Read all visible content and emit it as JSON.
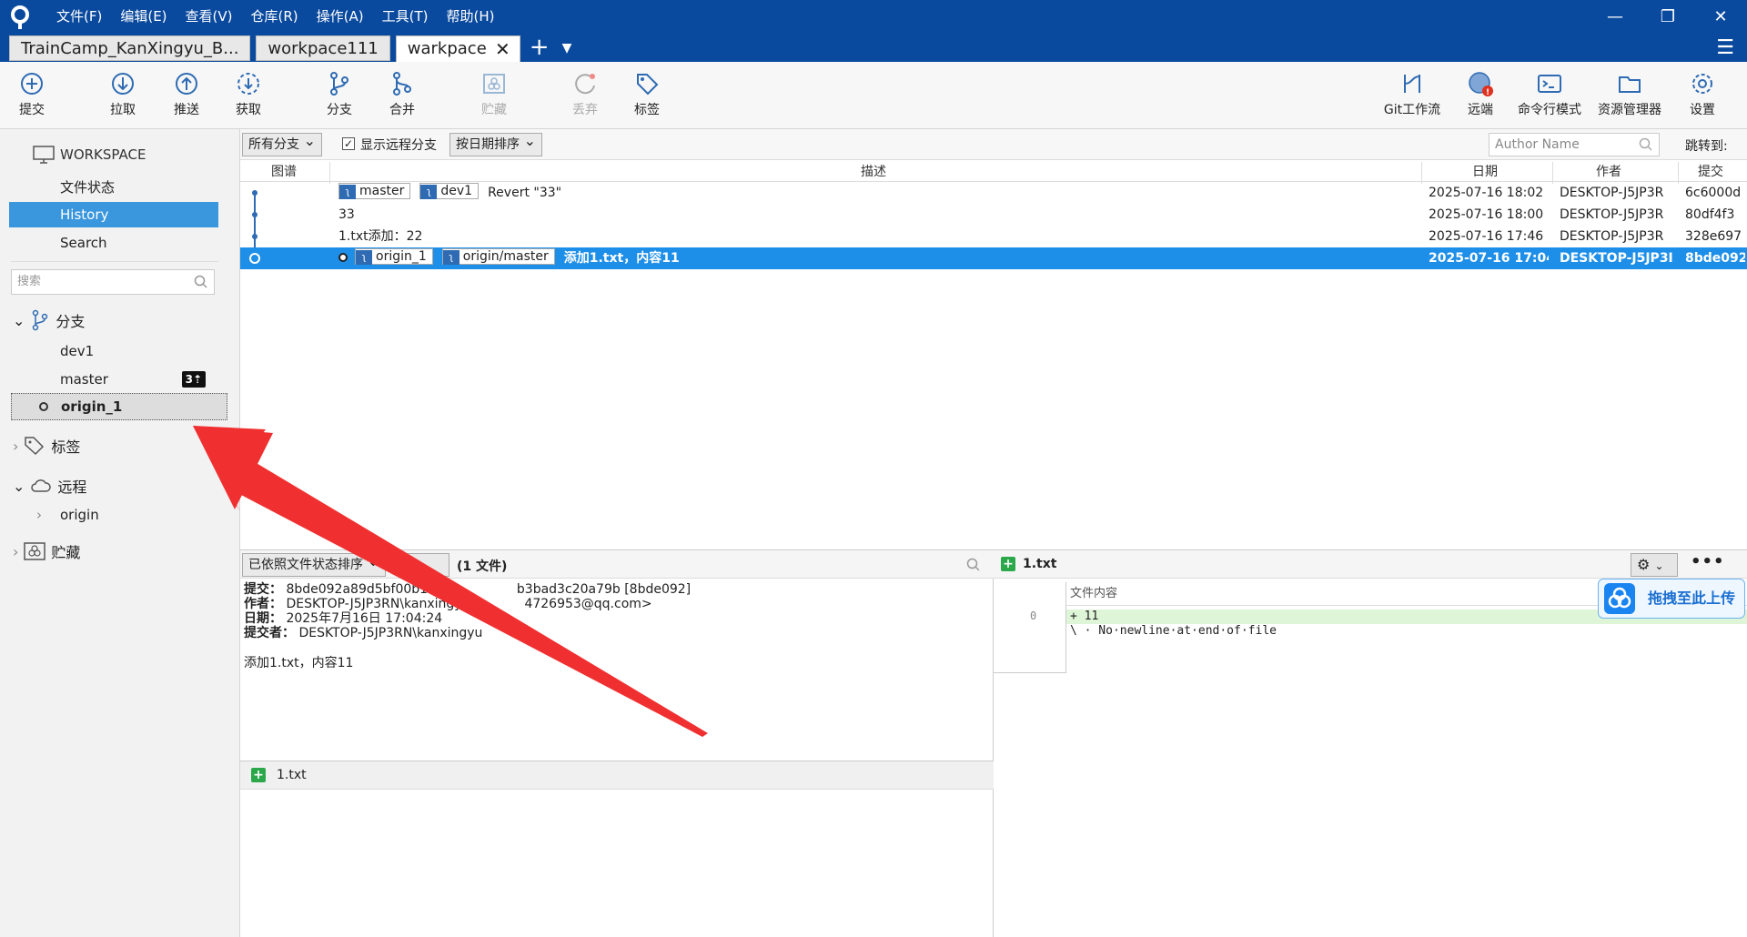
{
  "menu": [
    "文件(F)",
    "编辑(E)",
    "查看(V)",
    "仓库(R)",
    "操作(A)",
    "工具(T)",
    "帮助(H)"
  ],
  "tabs": {
    "t1": "TrainCamp_KanXingyu_B...",
    "t2": "workpace111",
    "t3": "warkpace"
  },
  "toolbar": {
    "commit": "提交",
    "pull": "拉取",
    "push": "推送",
    "fetch": "获取",
    "branch": "分支",
    "merge": "合并",
    "stash": "贮藏",
    "discard": "丢弃",
    "tag": "标签",
    "gitflow": "Git工作流",
    "remote": "远端",
    "terminal": "命令行模式",
    "explorer": "资源管理器",
    "settings": "设置"
  },
  "sidebar": {
    "workspace": "WORKSPACE",
    "file_status": "文件状态",
    "history": "History",
    "search": "Search",
    "search_placeholder": "搜索",
    "branches": "分支",
    "branch_dev1": "dev1",
    "branch_master": "master",
    "master_badge": "3⇡",
    "branch_origin1": "origin_1",
    "tags": "标签",
    "remotes": "远程",
    "remote_origin": "origin",
    "stashes": "贮藏"
  },
  "filter": {
    "all_branches": "所有分支",
    "show_remote": "显示远程分支",
    "sort_date": "按日期排序",
    "author_placeholder": "Author Name",
    "jump_to": "跳转到:"
  },
  "columns": {
    "graph": "图谱",
    "desc": "描述",
    "date": "日期",
    "author": "作者",
    "commit": "提交"
  },
  "commits": [
    {
      "ref1": "master",
      "ref2": "dev1",
      "desc": "Revert \"33\"",
      "date": "2025-07-16 18:02",
      "author": "DESKTOP-J5JP3R",
      "hash": "6c6000d"
    },
    {
      "desc": "33",
      "date": "2025-07-16 18:00",
      "author": "DESKTOP-J5JP3R",
      "hash": "80df4f3"
    },
    {
      "desc": "1.txt添加：22",
      "date": "2025-07-16 17:46",
      "author": "DESKTOP-J5JP3R",
      "hash": "328e697"
    },
    {
      "ref1": "origin_1",
      "ref2": "origin/master",
      "desc": "添加1.txt，内容11",
      "date": "2025-07-16 17:04",
      "author": "DESKTOP-J5JP3I",
      "hash": "8bde092"
    }
  ],
  "details": {
    "sort_by_status": "已依照文件状态排序",
    "file_count": "(1 文件)",
    "commit_label": "提交：",
    "commit_value": "8bde092a89d5bf00b129",
    "commit_value_tail": "b3bad3c20a79b [8bde092]",
    "author_label": "作者：",
    "author_value": "DESKTOP-J5JP3RN\\kanxingyu",
    "author_tail": "4726953@qq.com>",
    "date_label": "日期：",
    "date_value": "2025年7月16日 17:04:24",
    "committer_label": "提交者：",
    "committer_value": "DESKTOP-J5JP3RN\\kanxingyu",
    "message": "添加1.txt，内容11",
    "file": "1.txt"
  },
  "diff": {
    "file": "1.txt",
    "header": "文件内容",
    "line_no": "0",
    "line1": "+ 11",
    "line2": "\\ · No·newline·at·end·of·file",
    "upload": "拖拽至此上传"
  },
  "colors": {
    "titlebar": "#0a4a9e",
    "selection": "#1e8fe8",
    "arrow": "#f03030"
  }
}
